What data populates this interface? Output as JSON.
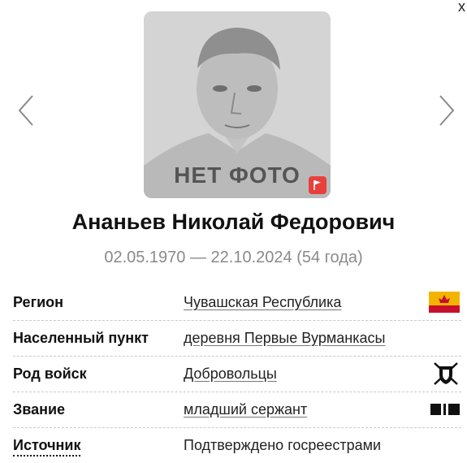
{
  "nav": {
    "close_glyph": "x",
    "prev_icon": "chevron-left-icon",
    "next_icon": "chevron-right-icon"
  },
  "photo": {
    "placeholder_text": "НЕТ ФОТО",
    "report_icon": "flag-icon"
  },
  "person": {
    "name": "Ананьев Николай Федорович",
    "dates": "02.05.1970 — 22.10.2024 (54 года)"
  },
  "details": [
    {
      "label": "Регион",
      "value": "Чувашская Республика",
      "icon": "region-flag-icon"
    },
    {
      "label": "Населенный пункт",
      "value": "деревня Первые Вурманкасы"
    },
    {
      "label": "Род войск",
      "value": "Добровольцы",
      "icon": "volunteers-emblem-icon"
    },
    {
      "label": "Звание",
      "value": "младший сержант",
      "icon": "rank-insignia-icon"
    },
    {
      "label": "Источник",
      "value": "Подтверждено госреестрами"
    }
  ],
  "colors": {
    "accent_red": "#e8403c",
    "flag_yellow": "#f2b400",
    "flag_red": "#c8102e",
    "muted_text": "#8a8a8a"
  }
}
